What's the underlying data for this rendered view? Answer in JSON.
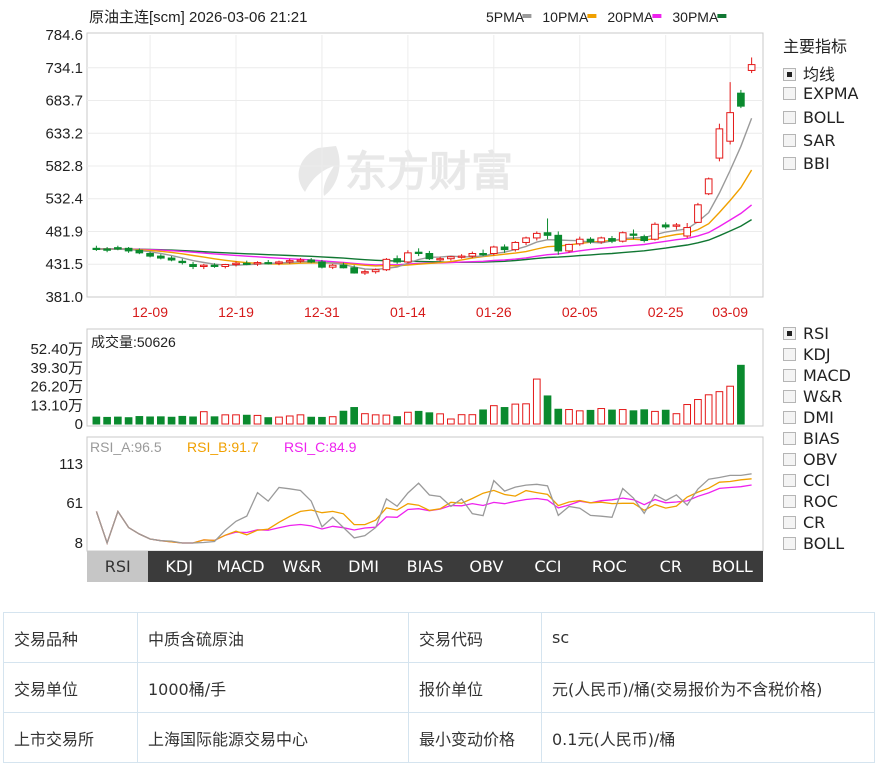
{
  "chart_data": {
    "type": "candlestick",
    "title": "原油主连[scm] 2026-03-06 21:21",
    "legend": [
      {
        "name": "5PMA",
        "color": "#9a9a9a"
      },
      {
        "name": "10PMA",
        "color": "#f0a000"
      },
      {
        "name": "20PMA",
        "color": "#ee22ee"
      },
      {
        "name": "30PMA",
        "color": "#117733"
      }
    ],
    "price_axis": {
      "ylim": [
        381.0,
        784.6
      ],
      "ticks": [
        "784.6",
        "734.1",
        "683.7",
        "633.2",
        "582.8",
        "532.4",
        "481.9",
        "431.5",
        "381.0"
      ]
    },
    "date_ticks": [
      {
        "label": "12-09",
        "index": 5
      },
      {
        "label": "12-19",
        "index": 13
      },
      {
        "label": "12-31",
        "index": 21
      },
      {
        "label": "01-14",
        "index": 29
      },
      {
        "label": "01-26",
        "index": 37
      },
      {
        "label": "02-05",
        "index": 45
      },
      {
        "label": "02-25",
        "index": 53
      },
      {
        "label": "03-09",
        "index": 59
      }
    ],
    "ohlc": [
      [
        456,
        460,
        452,
        455
      ],
      [
        455,
        458,
        450,
        453
      ],
      [
        457,
        460,
        453,
        455
      ],
      [
        456,
        458,
        449,
        452
      ],
      [
        453,
        456,
        447,
        449
      ],
      [
        448,
        451,
        442,
        444
      ],
      [
        444,
        447,
        439,
        441
      ],
      [
        441,
        444,
        436,
        438
      ],
      [
        436,
        440,
        431,
        434
      ],
      [
        431,
        435,
        424,
        428
      ],
      [
        428,
        432,
        424,
        430
      ],
      [
        430,
        433,
        426,
        428
      ],
      [
        428,
        432,
        425,
        431
      ],
      [
        431,
        436,
        428,
        433
      ],
      [
        433,
        437,
        430,
        432
      ],
      [
        432,
        436,
        429,
        434
      ],
      [
        434,
        438,
        431,
        433
      ],
      [
        433,
        437,
        430,
        435
      ],
      [
        435,
        440,
        432,
        437
      ],
      [
        437,
        441,
        434,
        438
      ],
      [
        438,
        441,
        433,
        435
      ],
      [
        435,
        438,
        425,
        427
      ],
      [
        427,
        432,
        424,
        430
      ],
      [
        430,
        434,
        425,
        426
      ],
      [
        426,
        430,
        417,
        418
      ],
      [
        418,
        423,
        415,
        420
      ],
      [
        420,
        425,
        417,
        423
      ],
      [
        423,
        441,
        421,
        439
      ],
      [
        440,
        445,
        432,
        435
      ],
      [
        435,
        453,
        433,
        449
      ],
      [
        450,
        456,
        444,
        448
      ],
      [
        448,
        452,
        438,
        440
      ],
      [
        439,
        443,
        436,
        440
      ],
      [
        440,
        444,
        437,
        443
      ],
      [
        443,
        447,
        440,
        444
      ],
      [
        444,
        451,
        441,
        448
      ],
      [
        448,
        454,
        444,
        446
      ],
      [
        448,
        460,
        445,
        458
      ],
      [
        458,
        462,
        449,
        454
      ],
      [
        454,
        467,
        451,
        465
      ],
      [
        465,
        474,
        461,
        472
      ],
      [
        472,
        482,
        468,
        479
      ],
      [
        480,
        502,
        470,
        476
      ],
      [
        476,
        482,
        446,
        452
      ],
      [
        452,
        463,
        449,
        462
      ],
      [
        463,
        474,
        460,
        470
      ],
      [
        470,
        473,
        463,
        466
      ],
      [
        466,
        474,
        463,
        472
      ],
      [
        471,
        475,
        464,
        467
      ],
      [
        467,
        482,
        465,
        480
      ],
      [
        478,
        485,
        470,
        476
      ],
      [
        474,
        477,
        465,
        468
      ],
      [
        470,
        496,
        468,
        493
      ],
      [
        492,
        496,
        486,
        489
      ],
      [
        490,
        495,
        485,
        492
      ],
      [
        475,
        495,
        472,
        488
      ],
      [
        496,
        526,
        495,
        523
      ],
      [
        540,
        565,
        538,
        563
      ],
      [
        595,
        648,
        590,
        640
      ],
      [
        621,
        712,
        616,
        665
      ],
      [
        695,
        700,
        672,
        675
      ],
      [
        730,
        750,
        726,
        739
      ]
    ],
    "volume": {
      "label": "成交量",
      "value": "50626",
      "ylim": [
        0,
        52.4
      ],
      "ticks": [
        "52.40万",
        "39.30万",
        "26.20万",
        "13.10万",
        "0"
      ],
      "unit": "万",
      "values": [
        4.8,
        4.6,
        4.8,
        4.4,
        5.2,
        4.9,
        5.0,
        4.7,
        5.3,
        4.9,
        8.6,
        5.0,
        6.4,
        6.4,
        6.1,
        6.0,
        4.4,
        4.8,
        5.6,
        6.4,
        4.7,
        4.6,
        5.1,
        8.9,
        11.5,
        7.2,
        6.4,
        6.2,
        5.1,
        8.2,
        8.8,
        7.8,
        7.1,
        3.5,
        6.5,
        6.5,
        9.8,
        12.8,
        11.5,
        13.9,
        14.1,
        31.4,
        19.6,
        10.3,
        10.1,
        9.2,
        9.5,
        10.8,
        9.7,
        10.1,
        9.2,
        9.9,
        8.8,
        9.6,
        7.2,
        13.6,
        17.1,
        20.4,
        22.6,
        26.4,
        41.0
      ]
    },
    "rsi": {
      "ylim": [
        8,
        113
      ],
      "ticks": [
        "113",
        "61",
        "8"
      ],
      "labels": [
        {
          "text": "RSI_A:96.5",
          "color": "#9a9a9a"
        },
        {
          "text": "RSI_B:91.7",
          "color": "#f0a000"
        },
        {
          "text": "RSI_C:84.9",
          "color": "#ee22ee"
        }
      ]
    },
    "colors": {
      "up": "#e41818",
      "down": "#0a8a2e",
      "rsi_a": "#9a9a9a",
      "rsi_b": "#f0a000",
      "rsi_c": "#ee22ee",
      "ma30": "#117733"
    }
  },
  "indicators_panel": {
    "title": "主要指标",
    "main_items": [
      {
        "label": "均线",
        "checked": true
      },
      {
        "label": "EXPMA",
        "checked": false
      },
      {
        "label": "BOLL",
        "checked": false
      },
      {
        "label": "SAR",
        "checked": false
      },
      {
        "label": "BBI",
        "checked": false
      }
    ],
    "sub_items": [
      {
        "label": "RSI",
        "checked": true
      },
      {
        "label": "KDJ",
        "checked": false
      },
      {
        "label": "MACD",
        "checked": false
      },
      {
        "label": "W&R",
        "checked": false
      },
      {
        "label": "DMI",
        "checked": false
      },
      {
        "label": "BIAS",
        "checked": false
      },
      {
        "label": "OBV",
        "checked": false
      },
      {
        "label": "CCI",
        "checked": false
      },
      {
        "label": "ROC",
        "checked": false
      },
      {
        "label": "CR",
        "checked": false
      },
      {
        "label": "BOLL",
        "checked": false
      }
    ]
  },
  "tabs": [
    "RSI",
    "KDJ",
    "MACD",
    "W&R",
    "DMI",
    "BIAS",
    "OBV",
    "CCI",
    "ROC",
    "CR",
    "BOLL"
  ],
  "info_table": [
    [
      "交易品种",
      "中质含硫原油",
      "交易代码",
      "sc"
    ],
    [
      "交易单位",
      "1000桶/手",
      "报价单位",
      "元(人民币)/桶(交易报价为不含税价格)"
    ],
    [
      "上市交易所",
      "上海国际能源交易中心",
      "最小变动价格",
      "0.1元(人民币)/桶"
    ]
  ]
}
